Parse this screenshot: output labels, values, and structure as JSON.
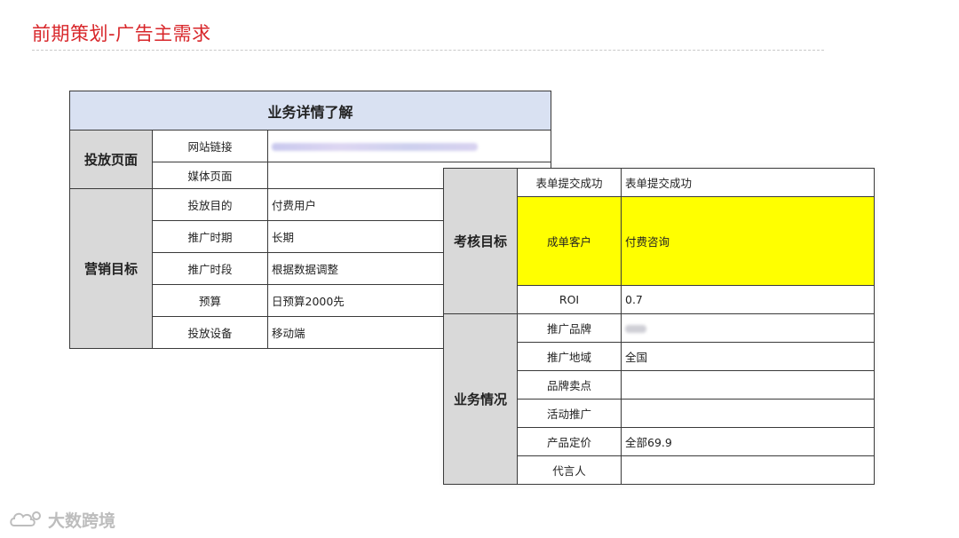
{
  "page": {
    "title": "前期策划-广告主需求"
  },
  "table1": {
    "header": "业务详情了解",
    "groups": [
      {
        "category": "投放页面",
        "rows": [
          {
            "label": "网站链接",
            "value": ""
          },
          {
            "label": "媒体页面",
            "value": ""
          }
        ]
      },
      {
        "category": "营销目标",
        "rows": [
          {
            "label": "投放目的",
            "value": "付费用户"
          },
          {
            "label": "推广时期",
            "value": "长期"
          },
          {
            "label": "推广时段",
            "value": "根据数据调整"
          },
          {
            "label": "预算",
            "value": "日预算2000先"
          },
          {
            "label": "投放设备",
            "value": "移动端"
          }
        ]
      }
    ]
  },
  "table2": {
    "groups": [
      {
        "category": "考核目标",
        "rows": [
          {
            "label": "表单提交成功",
            "value": "表单提交成功"
          },
          {
            "label": "成单客户",
            "value": "付费咨询"
          },
          {
            "label": "ROI",
            "value": "0.7"
          }
        ]
      },
      {
        "category": "业务情况",
        "rows": [
          {
            "label": "推广品牌",
            "value": ""
          },
          {
            "label": "推广地域",
            "value": "全国"
          },
          {
            "label": "品牌卖点",
            "value": ""
          },
          {
            "label": "活动推广",
            "value": ""
          },
          {
            "label": "产品定价",
            "value": "全部69.9"
          },
          {
            "label": "代言人",
            "value": ""
          }
        ]
      }
    ]
  },
  "colors": {
    "title": "#d8262a",
    "header_bg": "#d9e1f2",
    "category_bg": "#d9d9d9",
    "highlight": "#ffff00"
  },
  "watermark": {
    "text": "大数跨境",
    "icon": "cloud-logo-icon"
  }
}
